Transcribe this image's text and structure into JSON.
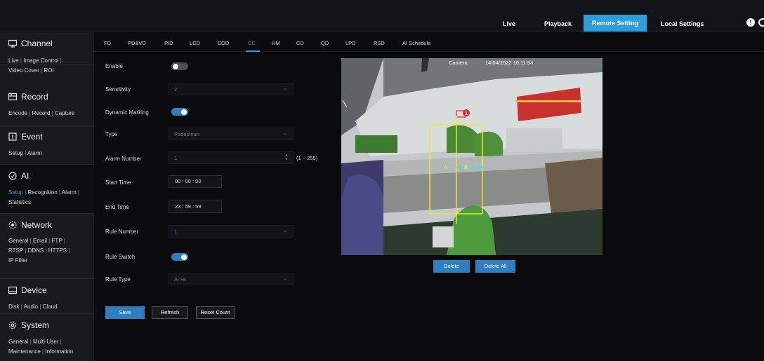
{
  "topnav": {
    "live": "Live",
    "playback": "Playback",
    "remote_setting": "Remote Setting",
    "local_settings": "Local Settings",
    "alert_glyph": "!"
  },
  "sidebar": {
    "channel": {
      "title": "Channel",
      "links": [
        "Live",
        "Image Control",
        "Video Cover",
        "ROI"
      ]
    },
    "record": {
      "title": "Record",
      "links": [
        "Encode",
        "Record",
        "Capture"
      ]
    },
    "event": {
      "title": "Event",
      "links": [
        "Setup",
        "Alarm"
      ]
    },
    "ai": {
      "title": "AI",
      "links": [
        "Setup",
        "Recognition",
        "Alarm",
        "Statistics"
      ],
      "active_link": "Setup"
    },
    "network": {
      "title": "Network",
      "links": [
        "General",
        "Email",
        "FTP",
        "RTSP",
        "DDNS",
        "HTTPS",
        "IP Filter"
      ]
    },
    "device": {
      "title": "Device",
      "links": [
        "Disk",
        "Audio",
        "Cloud"
      ]
    },
    "system": {
      "title": "System",
      "links": [
        "General",
        "Multi-User",
        "Maintenance",
        "Information"
      ]
    }
  },
  "tabs": [
    "FD",
    "PD&VD",
    "PID",
    "LCD",
    "SOD",
    "CC",
    "HM",
    "CD",
    "QD",
    "LPD",
    "RSD",
    "AI Schedule"
  ],
  "active_tab": "CC",
  "form": {
    "enable": {
      "label": "Enable",
      "on": false
    },
    "sensitivity": {
      "label": "Sensitivity",
      "value": "2"
    },
    "dynamic_marking": {
      "label": "Dynamic Marking",
      "on": true
    },
    "type": {
      "label": "Type",
      "value": "Pedestrian"
    },
    "alarm_number": {
      "label": "Alarm Number",
      "value": "1",
      "range": "(1 ~ 255)"
    },
    "start_time": {
      "label": "Start Time",
      "value": "00  :  00  :  00"
    },
    "end_time": {
      "label": "End Time",
      "value": "23  :  59  :  59"
    },
    "rule_number": {
      "label": "Rule Number",
      "value": "1"
    },
    "rule_switch": {
      "label": "Rule Switch",
      "on": true
    },
    "rule_type": {
      "label": "Rule Type",
      "value": "A->B"
    }
  },
  "buttons": {
    "save": "Save",
    "refresh": "Refresh",
    "reset_count": "Reset Count",
    "delete": "Delete",
    "delete_all": "Delete All"
  },
  "camera": {
    "name": "Camera",
    "timestamp": "14/04/2022 10:11:54",
    "rule_marker": "1",
    "line_label_a": "A",
    "line_label_b": "B"
  },
  "colors": {
    "accent": "#2f9cdc",
    "toggle_on": "#2f7fc0",
    "rule_box": "#f0ec29",
    "rule_marker": "#e3262d"
  }
}
